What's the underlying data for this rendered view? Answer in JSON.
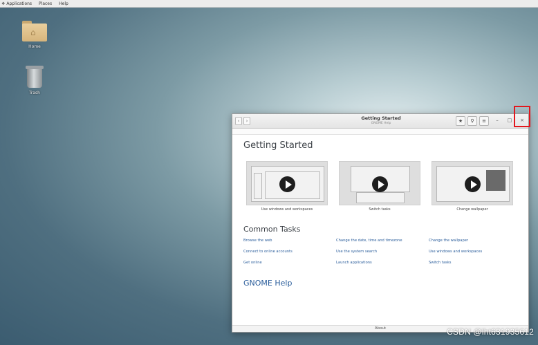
{
  "topbar": {
    "menus": [
      {
        "label": "Applications"
      },
      {
        "label": "Places"
      },
      {
        "label": "Help"
      }
    ]
  },
  "desktop": {
    "icons": [
      {
        "label": "Home"
      },
      {
        "label": "Trash"
      }
    ]
  },
  "window": {
    "title": "Getting Started",
    "subtitle": "GNOME Help",
    "breadcrumb": "",
    "page_heading": "Getting Started",
    "videos": [
      {
        "caption": "Use windows and workspaces"
      },
      {
        "caption": "Switch tasks"
      },
      {
        "caption": "Change wallpaper"
      }
    ],
    "common_tasks_heading": "Common Tasks",
    "tasks": [
      "Browse the web",
      "Change the date, time and timezone",
      "Change the wallpaper",
      "Connect to online accounts",
      "Use the system search",
      "Use windows and workspaces",
      "Get online",
      "Launch applications",
      "Switch tasks"
    ],
    "help_link": "GNOME Help",
    "footer": "About"
  },
  "watermark": "CSDN @lht631935612",
  "colors": {
    "highlight": "#e3171d",
    "link": "#2a5d9b"
  }
}
